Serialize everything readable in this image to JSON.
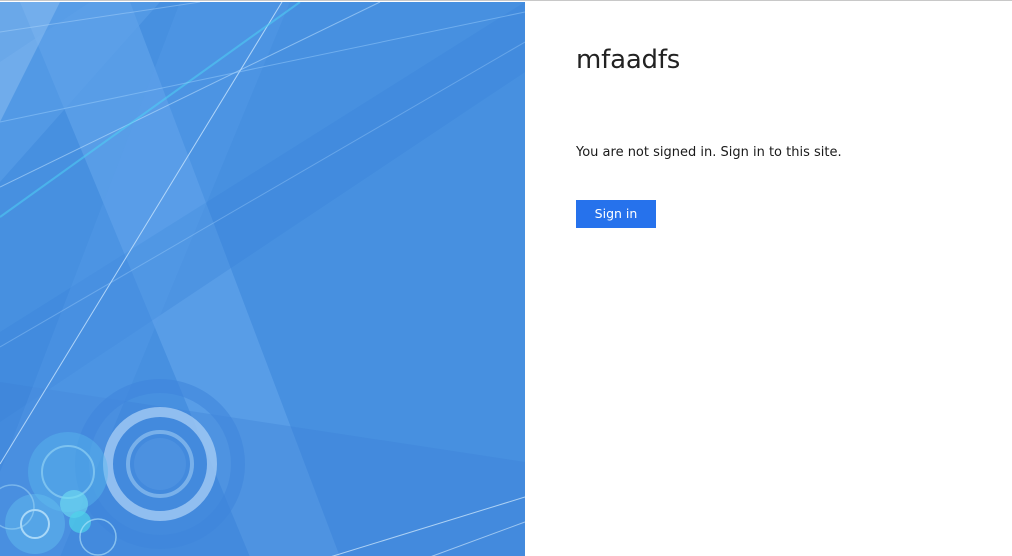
{
  "site_title": "mfaadfs",
  "message": "You are not signed in. Sign in to this site.",
  "sign_in_button": {
    "label": "Sign in",
    "color": "#2672ec"
  },
  "illustration": {
    "icon": "abstract-blue-background",
    "base_color": "#4790e0"
  }
}
